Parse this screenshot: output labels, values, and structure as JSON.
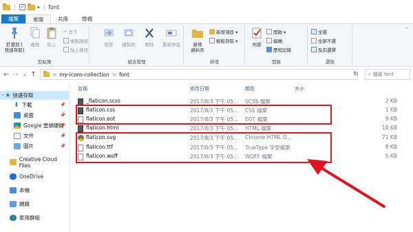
{
  "window": {
    "title": "font",
    "quick_access_divider": "|",
    "dropdown_glyph": "▾"
  },
  "ribbon_tabs": [
    {
      "label": "檔案",
      "type": "file"
    },
    {
      "label": "常用",
      "type": "active"
    },
    {
      "label": "共用",
      "type": "normal"
    },
    {
      "label": "檢視",
      "type": "normal"
    }
  ],
  "ribbon": {
    "clipboard": {
      "group_label": "剪貼簿",
      "pin_label_line1": "釘選到 [",
      "pin_label_line2": "快速存取]",
      "copy_label": "複製",
      "paste_label": "貼上",
      "cut_label": "剪下",
      "copy_path_label": "複製路徑",
      "paste_shortcut_label": "貼上捷徑"
    },
    "organize": {
      "group_label": "組合管理",
      "move_to_label": "移至",
      "copy_to_label": "複製到",
      "delete_label": "刪除",
      "rename_label": "重新命名"
    },
    "new": {
      "group_label": "新增",
      "new_folder_line1": "新增",
      "new_folder_line2": "資料夾",
      "new_item_label": "新增項目 ▾",
      "easy_access_label": "輕鬆存取 ▾"
    },
    "open": {
      "group_label": "開啟",
      "properties_label": "內容",
      "open_label": "開啟 ▾",
      "edit_label": "編輯",
      "history_label": "歷程記錄"
    },
    "select": {
      "group_label": "選取",
      "select_all_label": "全選",
      "select_none_label": "全部不選",
      "invert_label": "反向選擇"
    }
  },
  "address": {
    "breadcrumb_1": "my-icons-collection",
    "breadcrumb_2": "font",
    "separator": ">",
    "search_placeholder": "搜尋 font"
  },
  "nav_pane": [
    {
      "label": "快速存取",
      "icon": "star-icon",
      "quick": true,
      "pinned": false
    },
    {
      "label": "下載",
      "icon": "download-icon",
      "quick": false,
      "pinned": true
    },
    {
      "label": "桌面",
      "icon": "desktop-icon",
      "quick": false,
      "pinned": true
    },
    {
      "label": "Google 雲端硬碟",
      "icon": "google-drive-icon",
      "quick": false,
      "pinned": true
    },
    {
      "label": "文件",
      "icon": "documents-icon",
      "quick": false,
      "pinned": true
    },
    {
      "label": "圖片",
      "icon": "pictures-icon",
      "quick": false,
      "pinned": true
    },
    {
      "label": "Creative Cloud Files",
      "icon": "creative-cloud-icon",
      "quick": false,
      "pinned": false
    },
    {
      "label": "OneDrive",
      "icon": "onedrive-icon",
      "quick": false,
      "pinned": false
    },
    {
      "label": "本機",
      "icon": "this-pc-icon",
      "quick": false,
      "pinned": false
    },
    {
      "label": "網路",
      "icon": "network-icon",
      "quick": false,
      "pinned": false
    },
    {
      "label": "家用群組",
      "icon": "homegroup-icon",
      "quick": false,
      "pinned": false
    }
  ],
  "columns": {
    "name": "名稱",
    "date": "修改日期",
    "type": "類型",
    "size": "大小"
  },
  "files": [
    {
      "name": "_flaticon.scss",
      "date": "2017/8/3 下午 05...",
      "type": "SCSS 檔案",
      "size": "2 KB",
      "icon": "dark"
    },
    {
      "name": "flaticon.css",
      "date": "2017/8/3 下午 05...",
      "type": "CSS 檔案",
      "size": "1 KB",
      "icon": "dark"
    },
    {
      "name": "flaticon.eot",
      "date": "2017/8/3 下午 05...",
      "type": "EOT 檔案",
      "size": "9 KB",
      "icon": "plain"
    },
    {
      "name": "flaticon.html",
      "date": "2017/8/3 下午 05...",
      "type": "HTML 檔案",
      "size": "18 KB",
      "icon": "dark"
    },
    {
      "name": "flaticon.svg",
      "date": "2017/8/3 下午 05...",
      "type": "Chrome HTML D...",
      "size": "71 KB",
      "icon": "chrome"
    },
    {
      "name": "flaticon.ttf",
      "date": "2017/8/3 下午 05...",
      "type": "TrueType 字型檔案",
      "size": "8 KB",
      "icon": "plain"
    },
    {
      "name": "flaticon.woff",
      "date": "2017/8/3 下午 05...",
      "type": "WOFF 檔案",
      "size": "5 KB",
      "icon": "plain"
    }
  ],
  "colors": {
    "file_tab": "#1979ca",
    "quick_access_highlight": "#cce8ff",
    "annotation_red": "#e0141e"
  }
}
